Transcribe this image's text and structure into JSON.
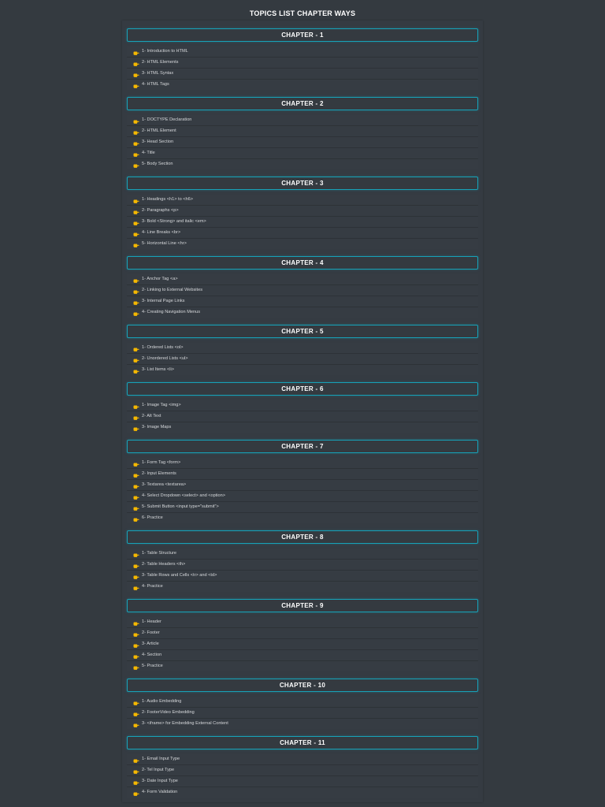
{
  "page": {
    "title": "TOPICS LIST CHAPTER WAYS"
  },
  "icons": {
    "topic_bullet": "pointing-hand-icon",
    "bullet_color": "#f5b800"
  },
  "colors": {
    "background": "#343a40",
    "header_border": "#17a2b8"
  },
  "chapters": [
    {
      "title": "CHAPTER - 1",
      "topics": [
        "1- Introduction to HTML",
        "2- HTML Elements",
        "3- HTML Syntax",
        "4- HTML Tags"
      ]
    },
    {
      "title": "CHAPTER - 2",
      "topics": [
        "1- DOCTYPE Declaration",
        "2- HTML Element",
        "3- Head Section",
        "4- Title",
        "5- Body Section"
      ]
    },
    {
      "title": "CHAPTER - 3",
      "topics": [
        "1- Headings <h1> to <h6>",
        "2- Paragraphs <p>",
        "3- Bold <Strong> and italic <em>",
        "4- Line Breaks <br>",
        "5- Horizontal Line <hr>"
      ]
    },
    {
      "title": "CHAPTER - 4",
      "topics": [
        "1- Anchor Tag <a>",
        "2- Linking to External Websites",
        "3- Internal Page Links",
        "4- Creating Navigation Menus"
      ]
    },
    {
      "title": "CHAPTER - 5",
      "topics": [
        "1- Ordered Lists <ol>",
        "2- Unordered Lists <ul>",
        "3- List Items <li>"
      ]
    },
    {
      "title": "CHAPTER - 6",
      "topics": [
        "1- Image Tag <img>",
        "2- Alt Text",
        "3- Image Maps"
      ]
    },
    {
      "title": "CHAPTER - 7",
      "topics": [
        "1- Form Tag <form>",
        "2- Input Elements",
        "3- Textarea <textarea>",
        "4- Select Dropdown <select> and <option>",
        "5- Submit Button <input type=\"submit\">",
        "6- Practice"
      ]
    },
    {
      "title": "CHAPTER - 8",
      "topics": [
        "1- Table Structure",
        "2- Table Headers <th>",
        "3- Table Rows and Cells <tr> and <td>",
        "4- Practice"
      ]
    },
    {
      "title": "CHAPTER - 9",
      "topics": [
        "1- Header",
        "2- Footer",
        "3- Article",
        "4- Section",
        "5- Practice"
      ]
    },
    {
      "title": "CHAPTER - 10",
      "topics": [
        "1- Audio Embedding",
        "2- FooterVideo Embedding",
        "3- <iframe> for Embedding External Content"
      ]
    },
    {
      "title": "CHAPTER - 11",
      "topics": [
        "1- Email Input Type",
        "2- Tel Input Type",
        "3- Date Input Type",
        "4- Form Validation"
      ]
    }
  ]
}
